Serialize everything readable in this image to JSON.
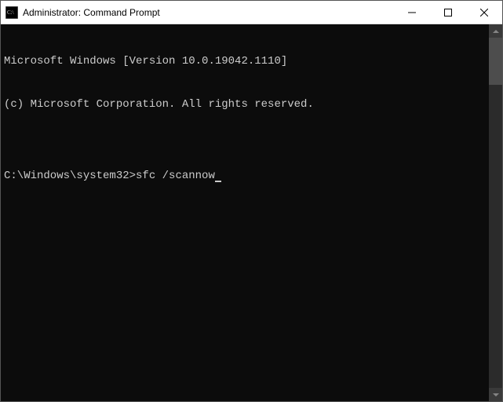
{
  "window": {
    "title": "Administrator: Command Prompt"
  },
  "terminal": {
    "line1": "Microsoft Windows [Version 10.0.19042.1110]",
    "line2": "(c) Microsoft Corporation. All rights reserved.",
    "blank": "",
    "prompt": "C:\\Windows\\system32>",
    "command": "sfc /scannow"
  }
}
